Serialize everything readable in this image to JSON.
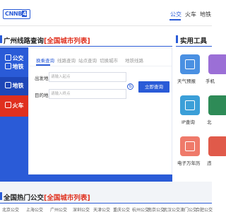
{
  "header": {
    "logo_text": "CNNB",
    "logo_badge": "4",
    "nav": [
      "公交",
      "火车",
      "地铁"
    ]
  },
  "route_section": {
    "title": "广州线路查询",
    "title_accent": "[全国城市列表]",
    "side_tabs": [
      "公交",
      "地铁",
      "地铁",
      "火车"
    ],
    "sub_tabs": [
      "换乘查询",
      "线路查询",
      "站点查询",
      "切换城市",
      "地铁线路"
    ],
    "from_label": "出发地",
    "from_placeholder": "请输入起点",
    "to_label": "目的地",
    "to_placeholder": "请输入终点",
    "swap_glyph": "⇅",
    "search_button": "立即查询"
  },
  "tools_section": {
    "title": "实用工具",
    "items": [
      {
        "label": "天气预报",
        "icon": "weather-icon",
        "color": "#4a90e2"
      },
      {
        "label": "手机",
        "icon": "phone-icon",
        "color": "#9b6fd6"
      },
      {
        "label": "IP查询",
        "icon": "monitor-icon",
        "color": "#3b9fd8"
      },
      {
        "label": "北",
        "icon": "compass-icon",
        "color": "#2e8b57"
      },
      {
        "label": "电子万年历",
        "icon": "calendar-icon",
        "color": "#ef7a6a"
      },
      {
        "label": "违",
        "icon": "car-icon",
        "color": "#e05a4a"
      }
    ]
  },
  "hot_section": {
    "title": "全国热门公交",
    "title_accent": "[全国城市列表]",
    "cities": [
      "北京公交",
      "上海公交",
      "广州公交",
      "深圳公交",
      "天津公交",
      "重庆公交",
      "杭州公交",
      "南京公交",
      "武汉公交",
      "澳门公交",
      "合肥公交",
      "郑州公交"
    ]
  }
}
